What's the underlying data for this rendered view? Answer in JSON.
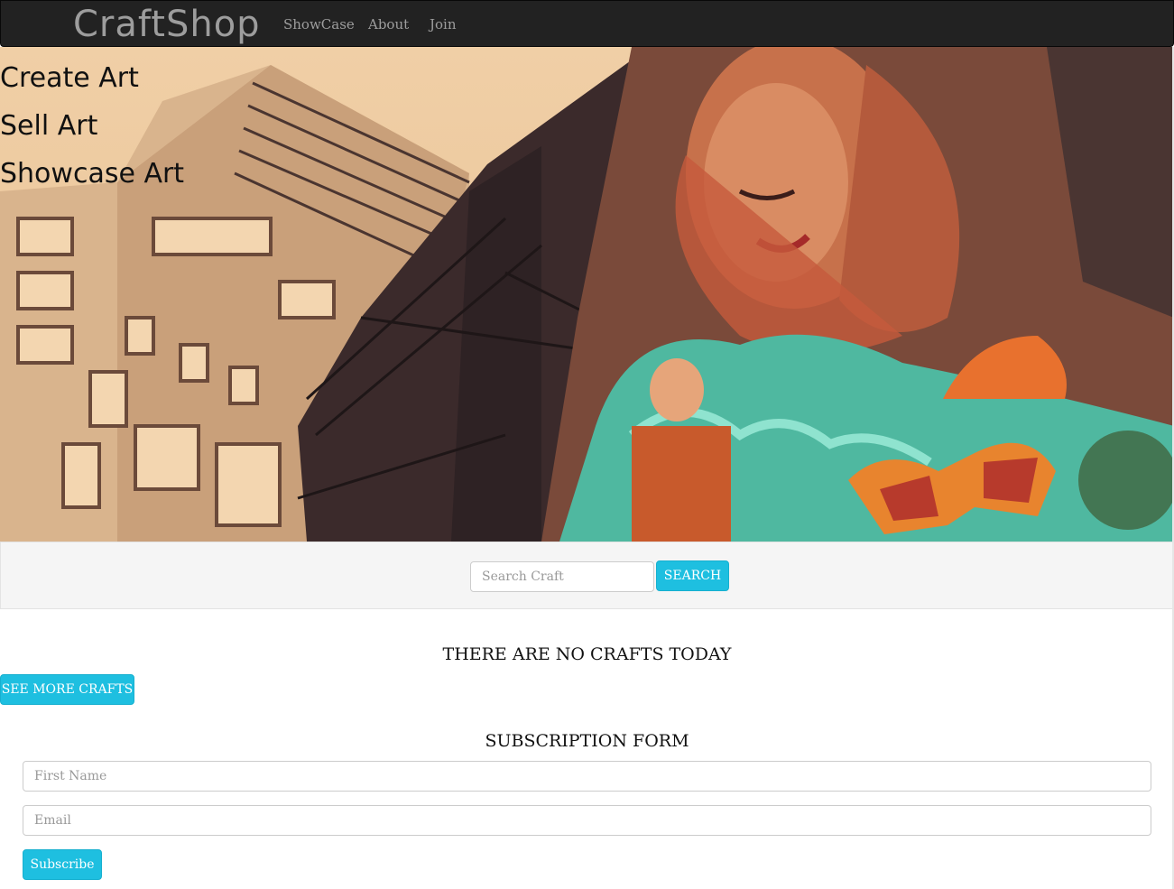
{
  "navbar": {
    "brand": "CraftShop",
    "links": [
      "ShowCase",
      "About",
      "Join"
    ]
  },
  "hero": {
    "lines": [
      "Create Art",
      "Sell Art",
      "Showcase Art"
    ]
  },
  "search": {
    "placeholder": "Search Craft",
    "button_label": "SEARCH"
  },
  "crafts": {
    "empty_message": "THERE ARE NO CRAFTS TODAY",
    "see_more_label": "SEE MORE CRAFTS"
  },
  "subscription": {
    "title": "SUBSCRIPTION FORM",
    "first_name_placeholder": "First Name",
    "email_placeholder": "Email",
    "submit_label": "Subscribe"
  },
  "colors": {
    "navbar_bg": "#222222",
    "nav_text": "#9d9d9d",
    "accent": "#1ebfe0",
    "strip_bg": "#f5f5f5"
  }
}
